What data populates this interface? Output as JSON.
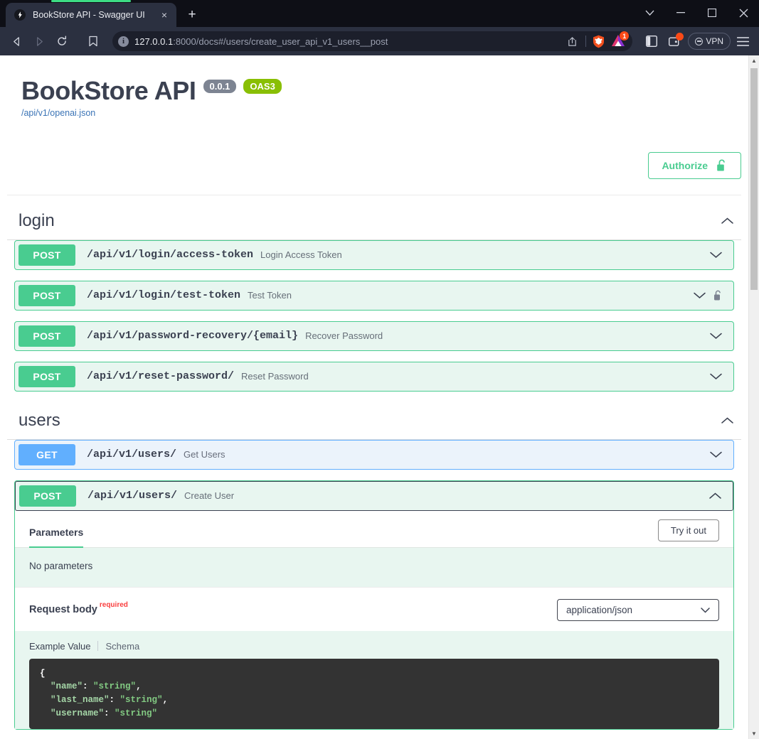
{
  "browser": {
    "tab_title": "BookStore API - Swagger UI",
    "tab_close_label": "×",
    "new_tab_label": "+",
    "url_host": "127.0.0.1",
    "url_rest": ":8000/docs#/users/create_user_api_v1_users__post",
    "vpn_label": "VPN",
    "leo_badge": "1",
    "win_minimize": "—",
    "win_maximize": "□",
    "win_close": "✕"
  },
  "page": {
    "title": "BookStore API",
    "version_badge": "0.0.1",
    "spec_badge": "OAS3",
    "spec_url": "/api/v1/openai.json",
    "authorize_label": "Authorize"
  },
  "tags": [
    {
      "name": "login",
      "operations": [
        {
          "method": "POST",
          "path": "/api/v1/login/access-token",
          "summary": "Login Access Token",
          "locked": false,
          "expanded": false
        },
        {
          "method": "POST",
          "path": "/api/v1/login/test-token",
          "summary": "Test Token",
          "locked": true,
          "expanded": false
        },
        {
          "method": "POST",
          "path": "/api/v1/password-recovery/{email}",
          "summary": "Recover Password",
          "locked": false,
          "expanded": false
        },
        {
          "method": "POST",
          "path": "/api/v1/reset-password/",
          "summary": "Reset Password",
          "locked": false,
          "expanded": false
        }
      ]
    },
    {
      "name": "users",
      "operations": [
        {
          "method": "GET",
          "path": "/api/v1/users/",
          "summary": "Get Users",
          "locked": false,
          "expanded": false
        },
        {
          "method": "POST",
          "path": "/api/v1/users/",
          "summary": "Create User",
          "locked": false,
          "expanded": true
        }
      ]
    }
  ],
  "expanded_operation": {
    "parameters_tab": "Parameters",
    "try_it_out_label": "Try it out",
    "no_parameters_text": "No parameters",
    "request_body_label": "Request body",
    "request_body_required": "required",
    "content_type": "application/json",
    "example_value_tab": "Example Value",
    "schema_tab": "Schema",
    "example_lines": [
      {
        "indent": 0,
        "text": "{",
        "type": "punc"
      },
      {
        "indent": 1,
        "key": "\"name\"",
        "value": "\"string\"",
        "comma": ","
      },
      {
        "indent": 1,
        "key": "\"last_name\"",
        "value": "\"string\"",
        "comma": ","
      },
      {
        "indent": 1,
        "key": "\"username\"",
        "value": "\"string\"",
        "comma": ""
      }
    ]
  },
  "colors": {
    "post_green": "#49cc90",
    "get_blue": "#61affe",
    "oas_green": "#89bf04",
    "version_gray": "#7d8492",
    "required_red": "#f93e3e",
    "link_blue": "#3b74b6"
  }
}
